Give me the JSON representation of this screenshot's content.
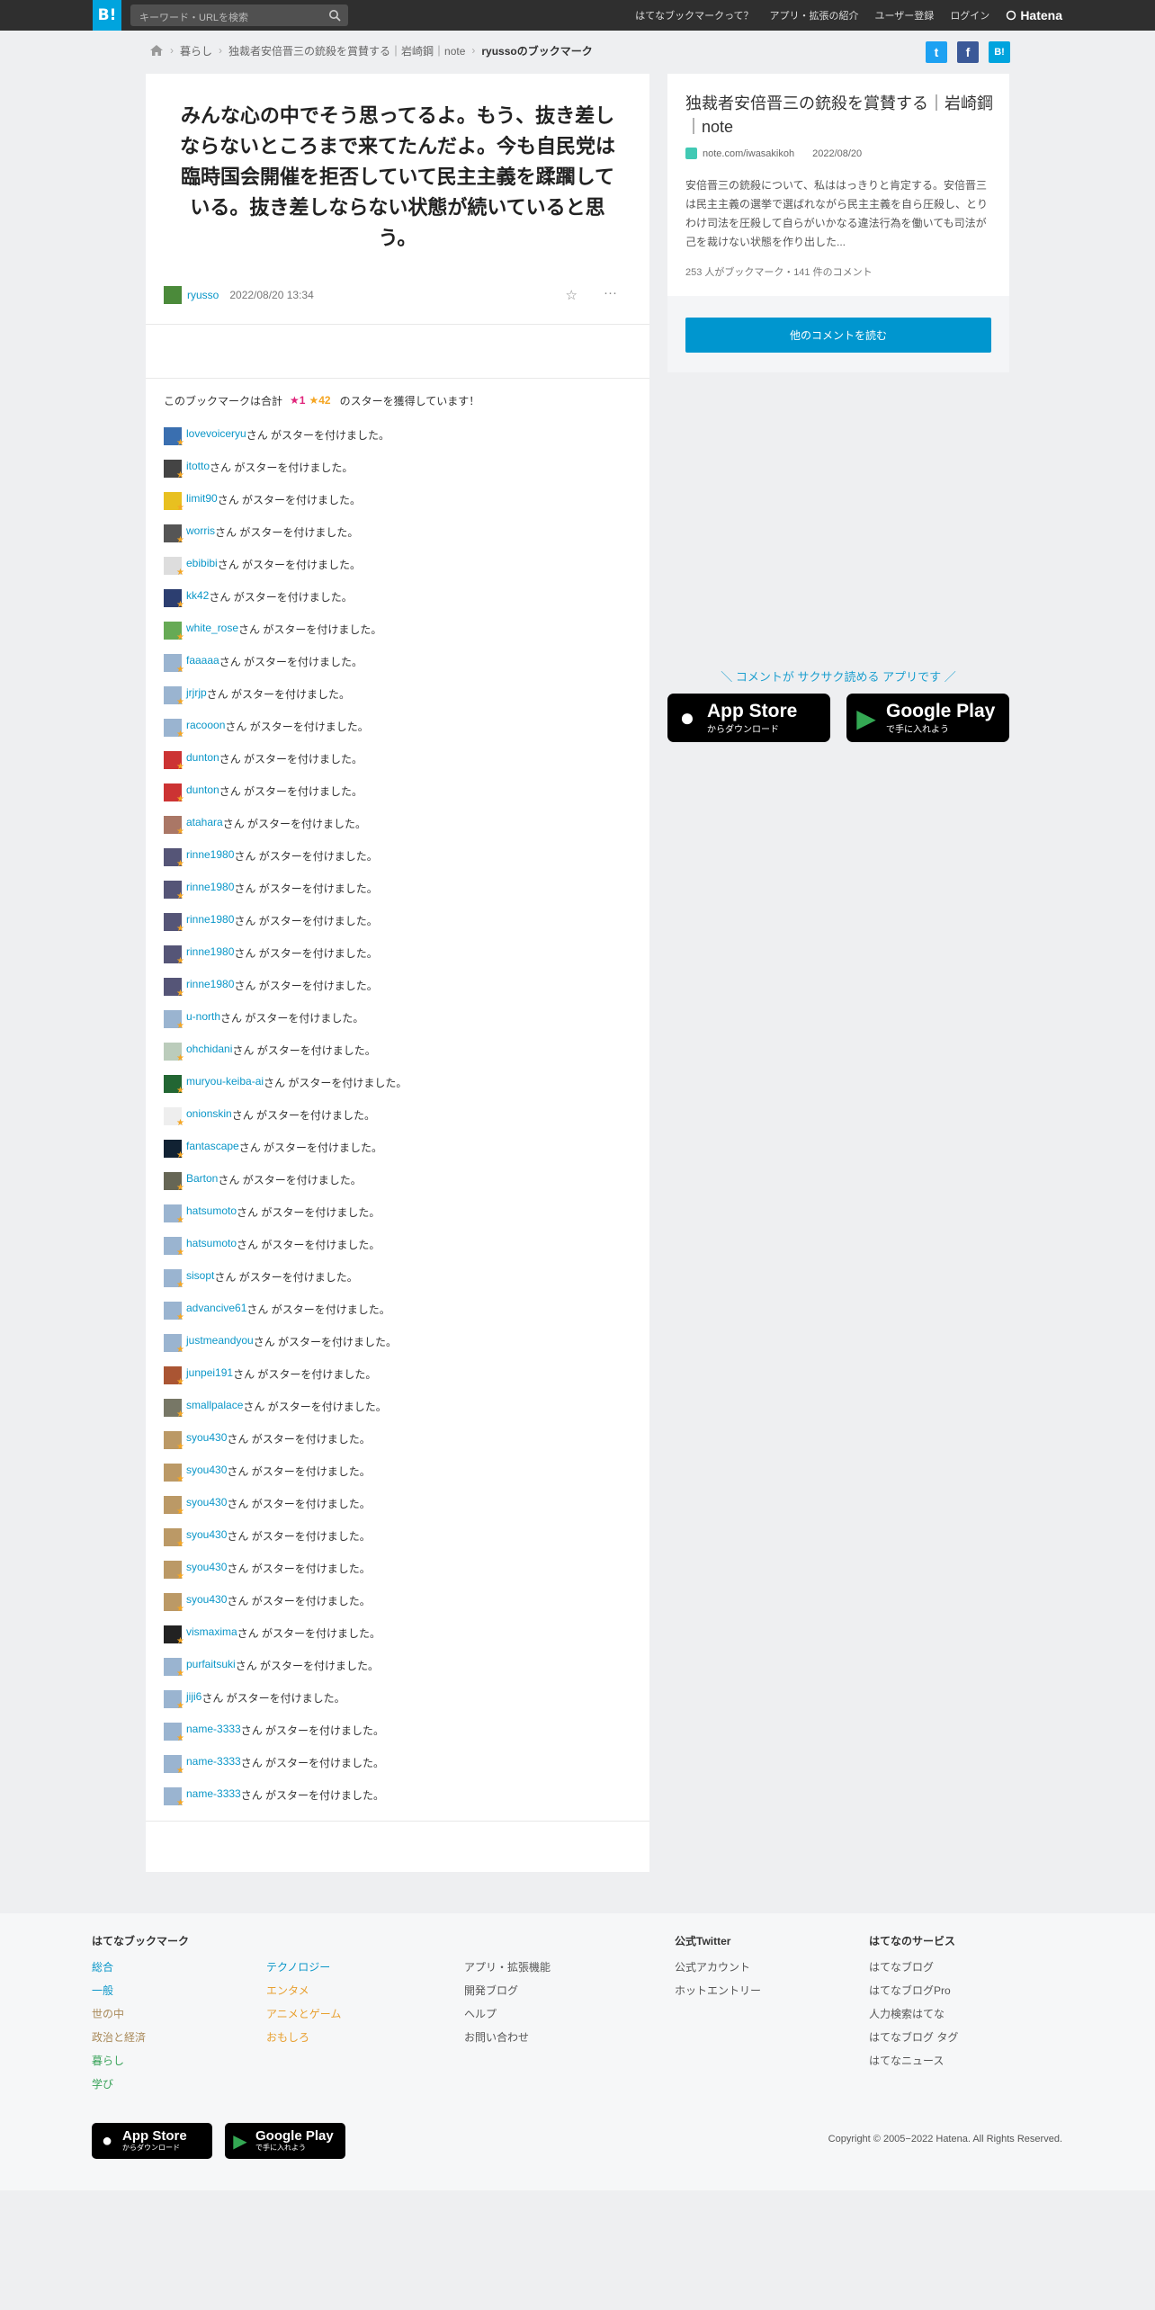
{
  "header": {
    "logo": "B!",
    "search_placeholder": "キーワード・URLを検索",
    "nav": [
      "はてなブックマークって？",
      "アプリ・拡張の紹介",
      "ユーザー登録",
      "ログイン"
    ],
    "brand": "Hatena"
  },
  "breadcrumb": {
    "items": [
      "暮らし",
      "独裁者安倍晋三の銃殺を賞賛する｜岩崎鋼｜note"
    ],
    "current": "ryussoのブックマーク"
  },
  "share": {
    "twitter": "t",
    "facebook": "f",
    "hatena": "B!"
  },
  "bookmark": {
    "comment": "みんな心の中でそう思ってるよ。もう、抜き差しならないところまで来てたんだよ。今も自民党は臨時国会開催を拒否していて民主主義を蹂躙している。抜き差しならない状態が続いていると思う。",
    "user": "ryusso",
    "datetime": "2022/08/20 13:34"
  },
  "stars": {
    "summary_pre": "このブックマークは合計",
    "pink": "★1",
    "yellow": "★42",
    "summary_post": "のスターを獲得しています！",
    "suffix": "さん がスターを付けました。",
    "users": [
      "lovevoiceryu",
      "itotto",
      "limit90",
      "worris",
      "ebibibi",
      "kk42",
      "white_rose",
      "faaaaa",
      "jrjrjp",
      "racooon",
      "dunton",
      "dunton",
      "atahara",
      "rinne1980",
      "rinne1980",
      "rinne1980",
      "rinne1980",
      "rinne1980",
      "u-north",
      "ohchidani",
      "muryou-keiba-ai",
      "onionskin",
      "fantascape",
      "Barton",
      "hatsumoto",
      "hatsumoto",
      "sisopt",
      "advancive61",
      "justmeandyou",
      "junpei191",
      "smallpalace",
      "syou430",
      "syou430",
      "syou430",
      "syou430",
      "syou430",
      "syou430",
      "vismaxima",
      "purfaitsuki",
      "jiji6",
      "name-3333",
      "name-3333",
      "name-3333"
    ]
  },
  "entry": {
    "title": "独裁者安倍晋三の銃殺を賞賛する｜岩崎鋼｜note",
    "site": "note.com/iwasakikoh",
    "date": "2022/08/20",
    "summary": "安倍晋三の銃殺について、私ははっきりと肯定する。安倍晋三は民主主義の選挙で選ばれながら民主主義を自ら圧殺し、とりわけ司法を圧殺して自らがいかなる違法行為を働いても司法が己を裁けない状態を作り出した...",
    "counts": "253 人がブックマーク・141 件のコメント",
    "other_button": "他のコメントを読む"
  },
  "promo": {
    "text": "＼ コメントが サクサク読める アプリです ／",
    "appstore_big": "App Store",
    "appstore_small": "からダウンロード",
    "googleplay_big": "Google Play",
    "googleplay_small": "で手に入れよう"
  },
  "footer": {
    "col1": {
      "heading": "はてなブックマーク",
      "links": [
        "総合",
        "一般",
        "世の中",
        "政治と経済",
        "暮らし",
        "学び"
      ]
    },
    "col2": {
      "links": [
        "テクノロジー",
        "エンタメ",
        "アニメとゲーム",
        "おもしろ"
      ]
    },
    "col3": {
      "links": [
        "アプリ・拡張機能",
        "開発ブログ",
        "ヘルプ",
        "お問い合わせ"
      ]
    },
    "col4": {
      "heading": "公式Twitter",
      "links": [
        "公式アカウント",
        "ホットエントリー"
      ]
    },
    "col5": {
      "heading": "はてなのサービス",
      "links": [
        "はてなブログ",
        "はてなブログPro",
        "人力検索はてな",
        "はてなブログ タグ",
        "はてなニュース"
      ]
    },
    "copyright": "Copyright © 2005−2022 Hatena. All Rights Reserved."
  },
  "colors": {
    "accent": "#00a4de",
    "link": "#0a96c8",
    "star_yellow": "#f5a623",
    "star_pink": "#e0257b"
  }
}
